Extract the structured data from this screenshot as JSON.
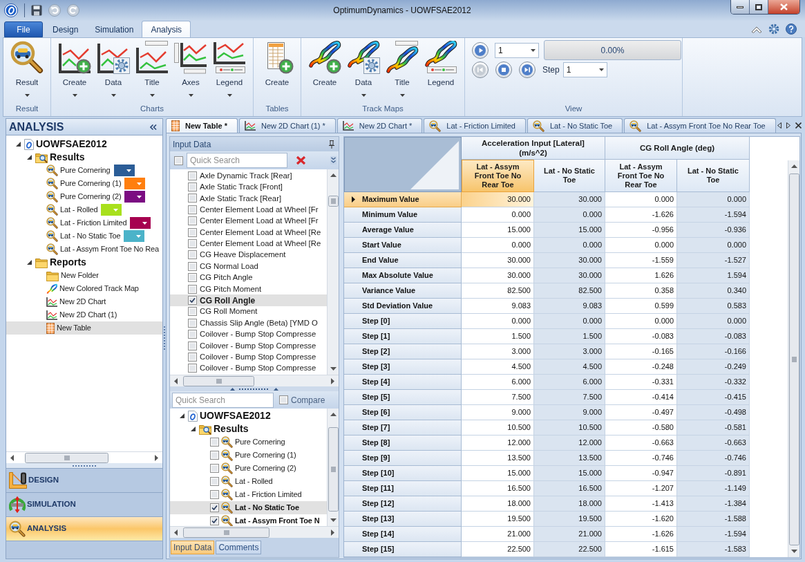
{
  "window": {
    "title": "OptimumDynamics - UOWFSAE2012"
  },
  "quick_access": [
    {
      "kind": "save",
      "disabled": false
    },
    {
      "kind": "undo",
      "disabled": true
    },
    {
      "kind": "redo",
      "disabled": true
    }
  ],
  "ribbon_tabs": [
    {
      "label": "File",
      "kind": "file",
      "selected": false
    },
    {
      "label": "Design",
      "kind": "tab",
      "selected": false
    },
    {
      "label": "Simulation",
      "kind": "tab",
      "selected": false
    },
    {
      "label": "Analysis",
      "kind": "tab",
      "selected": true
    }
  ],
  "ribbon_groups": [
    {
      "label": "Result",
      "buttons": [
        {
          "label": "Result",
          "kind": "result",
          "dropdown": true
        }
      ]
    },
    {
      "label": "Charts",
      "buttons": [
        {
          "label": "Create",
          "kind": "chart-create",
          "dropdown": true
        },
        {
          "label": "Data",
          "kind": "chart-data",
          "dropdown": true
        },
        {
          "label": "Title",
          "kind": "chart-title",
          "dropdown": true
        },
        {
          "label": "Axes",
          "kind": "chart-axes",
          "dropdown": true
        },
        {
          "label": "Legend",
          "kind": "chart-legend",
          "dropdown": true
        }
      ]
    },
    {
      "label": "Tables",
      "buttons": [
        {
          "label": "Create",
          "kind": "table-create",
          "dropdown": false
        }
      ]
    },
    {
      "label": "Track Maps",
      "buttons": [
        {
          "label": "Create",
          "kind": "track-create",
          "dropdown": false
        },
        {
          "label": "Data",
          "kind": "track-data",
          "dropdown": true
        },
        {
          "label": "Title",
          "kind": "track-title",
          "dropdown": true
        },
        {
          "label": "Legend",
          "kind": "track-legend",
          "dropdown": false
        }
      ]
    }
  ],
  "view_group": {
    "label": "View",
    "play": {
      "disabled": false
    },
    "play_dropdown": {
      "value": "1"
    },
    "progress": {
      "level": 0,
      "reading": "0.00%"
    },
    "transport": [
      {
        "kind": "rewind",
        "disabled": true
      },
      {
        "kind": "stop",
        "disabled": false
      },
      {
        "kind": "step-forward",
        "disabled": false
      }
    ],
    "step": {
      "label": "Step",
      "value": "1"
    }
  },
  "analysis_panel": {
    "title": "ANALYSIS",
    "tree": [
      {
        "label": "UOWFSAE2012",
        "kind": "project",
        "expanded": true,
        "selected": false,
        "children": [
          {
            "label": "Results",
            "kind": "results-folder",
            "expanded": true,
            "selected": false,
            "children": [
              {
                "label": "Pure Cornering",
                "kind": "result",
                "color": "#2b5d97",
                "selected": false
              },
              {
                "label": "Pure Cornering (1)",
                "kind": "result",
                "color": "#ff7f0e",
                "selected": false
              },
              {
                "label": "Pure Cornering (2)",
                "kind": "result",
                "color": "#7b0c82",
                "selected": false
              },
              {
                "label": "Lat - Rolled",
                "kind": "result",
                "color": "#a8e01c",
                "selected": false
              },
              {
                "label": "Lat - Friction Limited",
                "kind": "result",
                "color": "#a6004f",
                "selected": false
              },
              {
                "label": "Lat - No Static Toe",
                "kind": "result",
                "color": "#4bb3c9",
                "selected": false
              },
              {
                "label": "Lat - Assym Front Toe No Rea",
                "kind": "result",
                "selected": false
              }
            ]
          },
          {
            "label": "Reports",
            "kind": "folder",
            "expanded": true,
            "selected": false,
            "children": [
              {
                "label": "New Folder",
                "kind": "folder",
                "selected": false
              },
              {
                "label": "New Colored Track Map",
                "kind": "track-map",
                "selected": false
              },
              {
                "label": "New 2D Chart",
                "kind": "chart",
                "selected": false
              },
              {
                "label": "New 2D Chart (1)",
                "kind": "chart",
                "selected": false
              },
              {
                "label": "New Table",
                "kind": "table",
                "selected": true
              }
            ]
          }
        ]
      }
    ],
    "nav": [
      {
        "label": "DESIGN",
        "kind": "design",
        "selected": false
      },
      {
        "label": "SIMULATION",
        "kind": "simulation",
        "selected": false
      },
      {
        "label": "ANALYSIS",
        "kind": "analysis",
        "selected": true
      }
    ]
  },
  "document_tabs": [
    {
      "label": "New Table *",
      "kind": "table",
      "selected": true
    },
    {
      "label": "New 2D Chart (1) *",
      "kind": "chart",
      "selected": false
    },
    {
      "label": "New 2D Chart *",
      "kind": "chart",
      "selected": false
    },
    {
      "label": "Lat - Friction Limited",
      "kind": "result",
      "selected": false
    },
    {
      "label": "Lat - No Static Toe",
      "kind": "result",
      "selected": false
    },
    {
      "label": "Lat - Assym Front Toe No Rear Toe",
      "kind": "result",
      "selected": false
    }
  ],
  "input_data": {
    "title": "Input Data",
    "select_all": {
      "checked": false
    },
    "search": {
      "placeholder": "Quick Search"
    },
    "items": [
      {
        "label": "Axle Dynamic Track [Rear]",
        "checked": false,
        "selected": false
      },
      {
        "label": "Axle Static Track [Front]",
        "checked": false,
        "selected": false
      },
      {
        "label": "Axle Static Track [Rear]",
        "checked": false,
        "selected": false
      },
      {
        "label": "Center Element Load at Wheel [Fr",
        "checked": false,
        "selected": false
      },
      {
        "label": "Center Element Load at Wheel [Fr",
        "checked": false,
        "selected": false
      },
      {
        "label": "Center Element Load at Wheel [Re",
        "checked": false,
        "selected": false
      },
      {
        "label": "Center Element Load at Wheel [Re",
        "checked": false,
        "selected": false
      },
      {
        "label": "CG Heave Displacement",
        "checked": false,
        "selected": false
      },
      {
        "label": "CG Normal Load",
        "checked": false,
        "selected": false
      },
      {
        "label": "CG Pitch Angle",
        "checked": false,
        "selected": false
      },
      {
        "label": "CG Pitch Moment",
        "checked": false,
        "selected": false
      },
      {
        "label": "CG Roll Angle",
        "checked": true,
        "selected": true
      },
      {
        "label": "CG Roll Moment",
        "checked": false,
        "selected": false
      },
      {
        "label": "Chassis Slip Angle (Beta) [YMD O",
        "checked": false,
        "selected": false
      },
      {
        "label": "Coilover - Bump Stop Compresse",
        "checked": false,
        "selected": false
      },
      {
        "label": "Coilover - Bump Stop Compresse",
        "checked": false,
        "selected": false
      },
      {
        "label": "Coilover - Bump Stop Compresse",
        "checked": false,
        "selected": false
      },
      {
        "label": "Coilover - Bump Stop Compresse",
        "checked": false,
        "selected": false
      }
    ],
    "results_search": {
      "placeholder": "Quick Search"
    },
    "compare": {
      "label": "Compare",
      "checked": false
    },
    "results_tree": [
      {
        "label": "UOWFSAE2012",
        "kind": "project",
        "expanded": true,
        "selected": false,
        "children": [
          {
            "label": "Results",
            "kind": "results-folder",
            "expanded": true,
            "selected": false,
            "children": [
              {
                "label": "Pure Cornering",
                "kind": "result",
                "checked": false,
                "selected": false
              },
              {
                "label": "Pure Cornering (1)",
                "kind": "result",
                "checked": false,
                "selected": false
              },
              {
                "label": "Pure Cornering (2)",
                "kind": "result",
                "checked": false,
                "selected": false
              },
              {
                "label": "Lat - Rolled",
                "kind": "result",
                "checked": false,
                "selected": false
              },
              {
                "label": "Lat - Friction Limited",
                "kind": "result",
                "checked": false,
                "selected": false
              },
              {
                "label": "Lat - No Static Toe",
                "kind": "result",
                "checked": true,
                "selected": true
              },
              {
                "label": "Lat - Assym Front Toe N",
                "kind": "result",
                "checked": true,
                "selected": false
              }
            ]
          }
        ]
      }
    ],
    "tabs": [
      {
        "label": "Input Data",
        "selected": true
      },
      {
        "label": "Comments",
        "selected": false
      }
    ]
  },
  "table": {
    "column_groups": [
      {
        "label": "Acceleration Input [Lateral] (m/s^2)",
        "columns": [
          {
            "label": "Lat - Assym Front Toe No Rear Toe",
            "selected": true
          },
          {
            "label": "Lat - No Static Toe",
            "selected": false
          }
        ]
      },
      {
        "label": "CG Roll Angle (deg)",
        "columns": [
          {
            "label": "Lat - Assym Front Toe No Rear Toe",
            "selected": false
          },
          {
            "label": "Lat - No Static Toe",
            "selected": false
          }
        ]
      }
    ],
    "rows": [
      {
        "label": "Maximum Value",
        "selected": true,
        "cells": [
          "30.000",
          "30.000",
          "0.000",
          "0.000"
        ]
      },
      {
        "label": "Minimum Value",
        "selected": false,
        "cells": [
          "0.000",
          "0.000",
          "-1.626",
          "-1.594"
        ]
      },
      {
        "label": "Average Value",
        "selected": false,
        "cells": [
          "15.000",
          "15.000",
          "-0.956",
          "-0.936"
        ]
      },
      {
        "label": "Start Value",
        "selected": false,
        "cells": [
          "0.000",
          "0.000",
          "0.000",
          "0.000"
        ]
      },
      {
        "label": "End Value",
        "selected": false,
        "cells": [
          "30.000",
          "30.000",
          "-1.559",
          "-1.527"
        ]
      },
      {
        "label": "Max Absolute Value",
        "selected": false,
        "cells": [
          "30.000",
          "30.000",
          "1.626",
          "1.594"
        ]
      },
      {
        "label": "Variance Value",
        "selected": false,
        "cells": [
          "82.500",
          "82.500",
          "0.358",
          "0.340"
        ]
      },
      {
        "label": "Std Deviation Value",
        "selected": false,
        "cells": [
          "9.083",
          "9.083",
          "0.599",
          "0.583"
        ]
      },
      {
        "label": "Step [0]",
        "selected": false,
        "cells": [
          "0.000",
          "0.000",
          "0.000",
          "0.000"
        ]
      },
      {
        "label": "Step [1]",
        "selected": false,
        "cells": [
          "1.500",
          "1.500",
          "-0.083",
          "-0.083"
        ]
      },
      {
        "label": "Step [2]",
        "selected": false,
        "cells": [
          "3.000",
          "3.000",
          "-0.165",
          "-0.166"
        ]
      },
      {
        "label": "Step [3]",
        "selected": false,
        "cells": [
          "4.500",
          "4.500",
          "-0.248",
          "-0.249"
        ]
      },
      {
        "label": "Step [4]",
        "selected": false,
        "cells": [
          "6.000",
          "6.000",
          "-0.331",
          "-0.332"
        ]
      },
      {
        "label": "Step [5]",
        "selected": false,
        "cells": [
          "7.500",
          "7.500",
          "-0.414",
          "-0.415"
        ]
      },
      {
        "label": "Step [6]",
        "selected": false,
        "cells": [
          "9.000",
          "9.000",
          "-0.497",
          "-0.498"
        ]
      },
      {
        "label": "Step [7]",
        "selected": false,
        "cells": [
          "10.500",
          "10.500",
          "-0.580",
          "-0.581"
        ]
      },
      {
        "label": "Step [8]",
        "selected": false,
        "cells": [
          "12.000",
          "12.000",
          "-0.663",
          "-0.663"
        ]
      },
      {
        "label": "Step [9]",
        "selected": false,
        "cells": [
          "13.500",
          "13.500",
          "-0.746",
          "-0.746"
        ]
      },
      {
        "label": "Step [10]",
        "selected": false,
        "cells": [
          "15.000",
          "15.000",
          "-0.947",
          "-0.891"
        ]
      },
      {
        "label": "Step [11]",
        "selected": false,
        "cells": [
          "16.500",
          "16.500",
          "-1.207",
          "-1.149"
        ]
      },
      {
        "label": "Step [12]",
        "selected": false,
        "cells": [
          "18.000",
          "18.000",
          "-1.413",
          "-1.384"
        ]
      },
      {
        "label": "Step [13]",
        "selected": false,
        "cells": [
          "19.500",
          "19.500",
          "-1.620",
          "-1.588"
        ]
      },
      {
        "label": "Step [14]",
        "selected": false,
        "cells": [
          "21.000",
          "21.000",
          "-1.626",
          "-1.594"
        ]
      },
      {
        "label": "Step [15]",
        "selected": false,
        "cells": [
          "22.500",
          "22.500",
          "-1.615",
          "-1.583"
        ]
      }
    ]
  }
}
